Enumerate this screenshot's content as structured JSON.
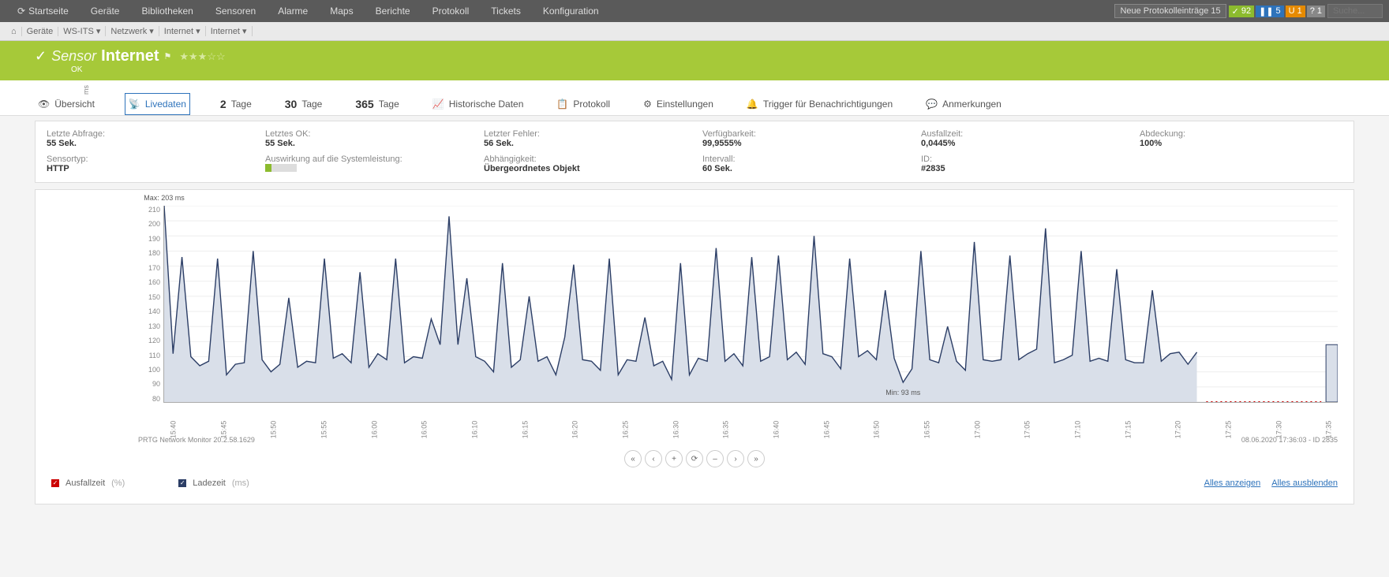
{
  "topnav": {
    "items": [
      "Startseite",
      "Geräte",
      "Bibliotheken",
      "Sensoren",
      "Alarme",
      "Maps",
      "Berichte",
      "Protokoll",
      "Tickets",
      "Konfiguration"
    ],
    "log_button": "Neue Protokolleinträge  15",
    "badges": [
      {
        "cls": "green",
        "icon": "✓",
        "n": "92"
      },
      {
        "cls": "b-blue",
        "icon": "❚❚",
        "n": "5"
      },
      {
        "cls": "b-orange",
        "icon": "U",
        "n": "1"
      },
      {
        "cls": "b-gray",
        "icon": "?",
        "n": "1"
      }
    ],
    "search_ph": "Suche..."
  },
  "breadcrumb": [
    "⌂",
    "Geräte",
    "WS-ITS  ▾",
    "Netzwerk  ▾",
    "Internet  ▾",
    "Internet  ▾"
  ],
  "hero": {
    "prefix": "Sensor",
    "name": "Internet",
    "status": "OK",
    "stars": "★★★☆☆"
  },
  "tabs": [
    {
      "icon": "👁",
      "label": "Übersicht"
    },
    {
      "icon": "📡",
      "label": "Livedaten",
      "active": true
    },
    {
      "num": "2",
      "label": "Tage"
    },
    {
      "num": "30",
      "label": "Tage"
    },
    {
      "num": "365",
      "label": "Tage"
    },
    {
      "icon": "📈",
      "label": "Historische Daten"
    },
    {
      "icon": "📋",
      "label": "Protokoll"
    },
    {
      "icon": "⚙",
      "label": "Einstellungen"
    },
    {
      "icon": "🔔",
      "label": "Trigger für Benachrichtigungen"
    },
    {
      "icon": "💬",
      "label": "Anmerkungen"
    }
  ],
  "info": {
    "row1": [
      {
        "lbl": "Letzte Abfrage:",
        "val": "55 Sek."
      },
      {
        "lbl": "Letztes OK:",
        "val": "55 Sek."
      },
      {
        "lbl": "Letzter Fehler:",
        "val": "56 Sek."
      },
      {
        "lbl": "Verfügbarkeit:",
        "val": "99,9555%"
      },
      {
        "lbl": "Ausfallzeit:",
        "val": "0,0445%"
      },
      {
        "lbl": "Abdeckung:",
        "val": "100%"
      }
    ],
    "row2": [
      {
        "lbl": "Sensortyp:",
        "val": "HTTP"
      },
      {
        "lbl": "Auswirkung auf die Systemleistung:",
        "perf": true
      },
      {
        "lbl": "Abhängigkeit:",
        "val": "Übergeordnetes Objekt"
      },
      {
        "lbl": "Intervall:",
        "val": "60 Sek."
      },
      {
        "lbl": "ID:",
        "val": "#2835"
      },
      {
        "lbl": "",
        "val": ""
      }
    ]
  },
  "chart_data": {
    "type": "area",
    "ylabel": "ms",
    "ylim": [
      80,
      210
    ],
    "yticks": [
      80,
      90,
      100,
      110,
      120,
      130,
      140,
      150,
      160,
      170,
      180,
      190,
      200,
      210
    ],
    "xticks": [
      "15:40",
      "15:45",
      "15:50",
      "15:55",
      "16:00",
      "16:05",
      "16:10",
      "16:15",
      "16:20",
      "16:25",
      "16:30",
      "16:35",
      "16:40",
      "16:45",
      "16:50",
      "16:55",
      "17:00",
      "17:05",
      "17:10",
      "17:15",
      "17:20",
      "17:25",
      "17:30",
      "17:35"
    ],
    "max_annot": "Max: 203 ms",
    "min_annot": "Min: 93 ms",
    "series": [
      {
        "name": "Ladezeit",
        "unit": "ms",
        "color": "#2c3e66",
        "values": [
          210,
          112,
          176,
          110,
          104,
          107,
          175,
          98,
          105,
          106,
          180,
          108,
          100,
          105,
          149,
          103,
          107,
          106,
          175,
          109,
          112,
          106,
          166,
          103,
          112,
          108,
          175,
          106,
          110,
          109,
          135,
          118,
          203,
          118,
          162,
          110,
          107,
          100,
          172,
          103,
          108,
          150,
          107,
          110,
          98,
          123,
          171,
          108,
          107,
          101,
          175,
          98,
          108,
          107,
          136,
          104,
          107,
          95,
          172,
          98,
          109,
          107,
          182,
          107,
          112,
          104,
          176,
          107,
          110,
          177,
          108,
          113,
          105,
          190,
          112,
          110,
          102,
          175,
          110,
          114,
          108,
          154,
          109,
          93,
          102,
          180,
          108,
          106,
          130,
          107,
          101,
          186,
          108,
          107,
          108,
          177,
          108,
          112,
          115,
          195,
          106,
          108,
          111,
          180,
          107,
          109,
          107,
          168,
          108,
          106,
          106,
          154,
          107,
          112,
          113,
          105,
          113
        ]
      },
      {
        "name": "Ausfallzeit",
        "unit": "%",
        "color": "#cc0000",
        "values": []
      }
    ],
    "outage_start_xtick": "17:20",
    "break_after_index": 116,
    "last_value": 118,
    "footer_left": "PRTG Network Monitor 20.2.58.1629",
    "footer_right": "08.06.2020 17:36:03 - ID 2835"
  },
  "controls": [
    "«",
    "‹",
    "+",
    "⟳",
    "–",
    "›",
    "»"
  ],
  "legend": {
    "items": [
      {
        "color": "#cc0000",
        "checked": true,
        "label": "Ausfallzeit",
        "unit": "(%)"
      },
      {
        "color": "#2c3e66",
        "checked": true,
        "label": "Ladezeit",
        "unit": "(ms)"
      }
    ],
    "show_all": "Alles anzeigen",
    "hide_all": "Alles ausblenden"
  }
}
